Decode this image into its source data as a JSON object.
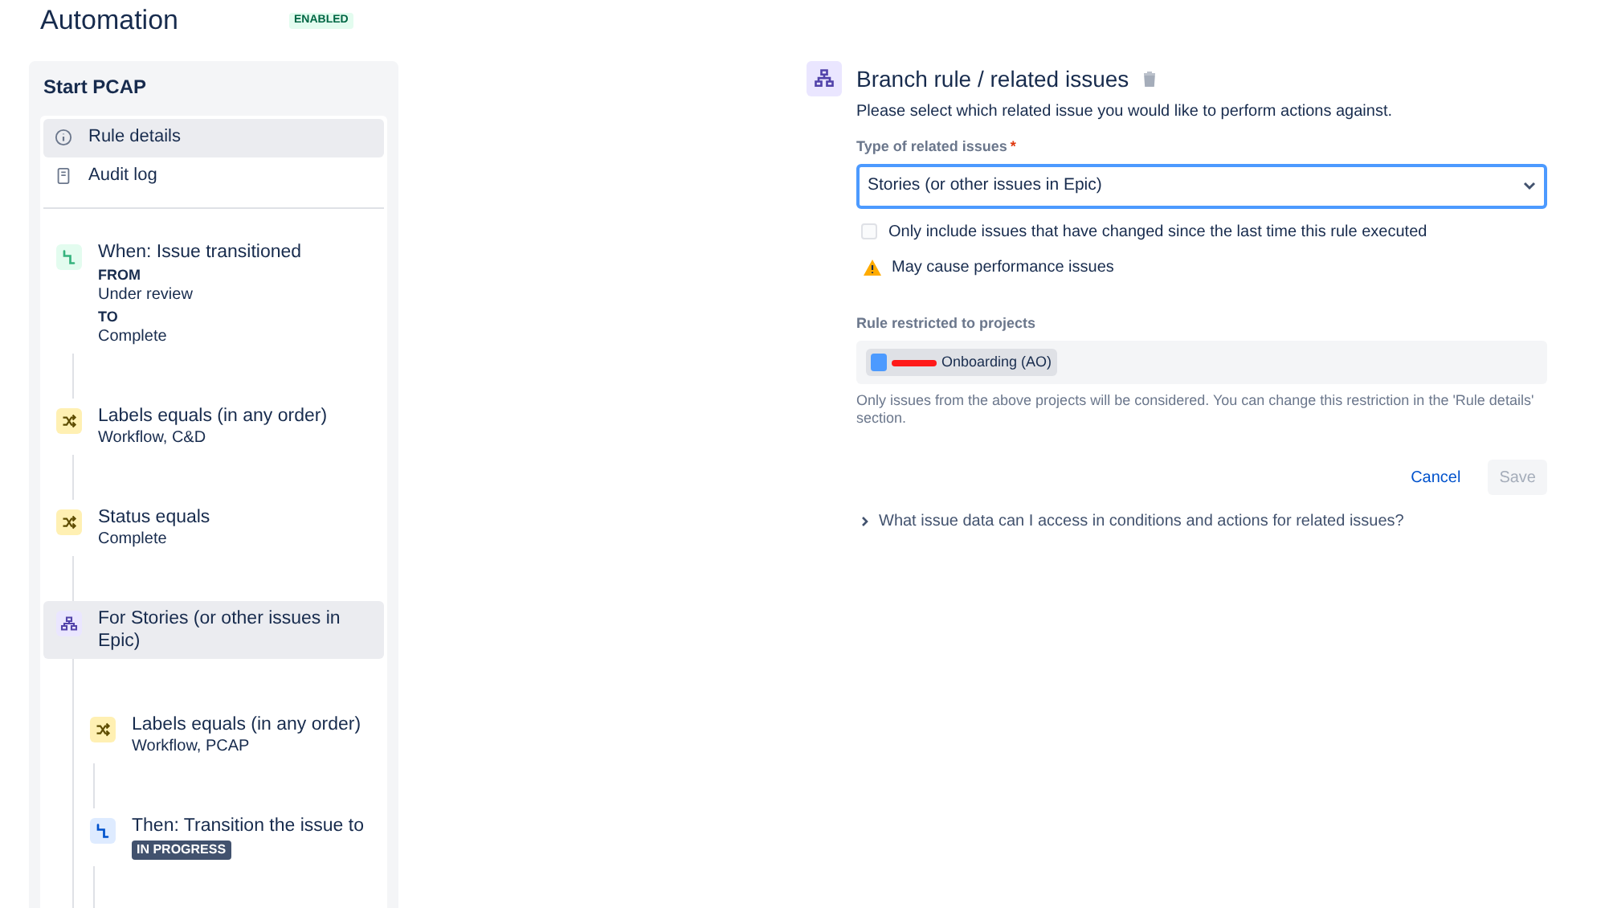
{
  "header": {
    "title": "Automation",
    "status": "ENABLED"
  },
  "rule_panel": {
    "title": "Start PCAP",
    "nav": [
      {
        "label": "Rule details",
        "selected": true
      },
      {
        "label": "Audit log",
        "selected": false
      }
    ],
    "steps": [
      {
        "kind": "trigger",
        "title": "When: Issue transitioned",
        "selected": false,
        "details": [
          {
            "kind": "label",
            "text": "FROM"
          },
          {
            "kind": "value",
            "text": "Under review"
          },
          {
            "kind": "label",
            "text": "TO"
          },
          {
            "kind": "value",
            "text": "Complete"
          }
        ]
      },
      {
        "kind": "condition",
        "title": "Labels equals (in any order)",
        "selected": false,
        "details": [
          {
            "kind": "value",
            "text": "Workflow, C&D"
          }
        ]
      },
      {
        "kind": "condition",
        "title": "Status equals",
        "selected": false,
        "details": [
          {
            "kind": "value",
            "text": "Complete"
          }
        ]
      },
      {
        "kind": "branch",
        "title": "For Stories (or other issues in Epic)",
        "selected": true,
        "children": [
          {
            "kind": "condition",
            "title": "Labels equals (in any order)",
            "selected": false,
            "details": [
              {
                "kind": "value",
                "text": "Workflow, PCAP"
              }
            ]
          },
          {
            "kind": "action",
            "title": "Then: Transition the issue to",
            "selected": false,
            "details": [
              {
                "kind": "lozenge",
                "text": "IN PROGRESS"
              }
            ]
          }
        ]
      }
    ]
  },
  "editor": {
    "title": "Branch rule / related issues",
    "description": "Please select which related issue you would like to perform actions against.",
    "type_field": {
      "label": "Type of related issues",
      "required_mark": "*",
      "value": "Stories (or other issues in Epic)"
    },
    "only_changed": {
      "label": "Only include issues that have changed since the last time this rule executed",
      "checked": false
    },
    "warning": "May cause performance issues",
    "projects": {
      "label": "Rule restricted to projects",
      "items": [
        "Onboarding (AO)"
      ],
      "help": "Only issues from the above projects will be considered. You can change this restriction in the 'Rule details' section."
    },
    "buttons": [
      {
        "label": "Cancel",
        "kind": "link",
        "disabled": false
      },
      {
        "label": "Save",
        "kind": "primary",
        "disabled": true
      }
    ],
    "faq": {
      "label": "What issue data can I access in conditions and actions for related issues?",
      "expanded": false
    }
  }
}
